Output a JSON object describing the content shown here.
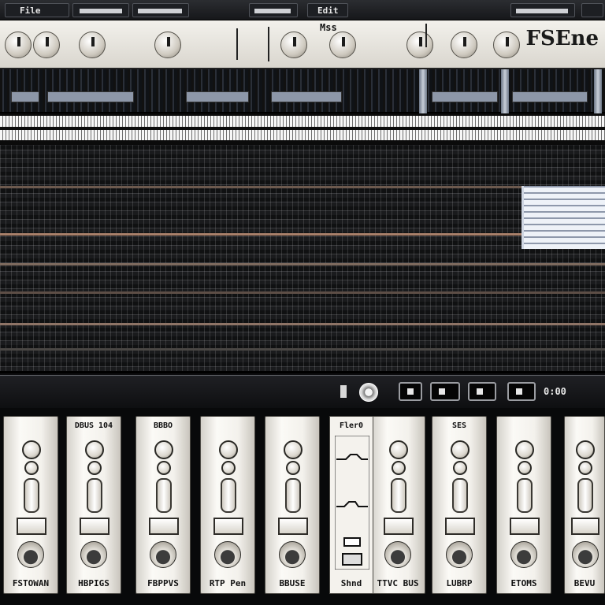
{
  "menubar": {
    "segment_1": "File",
    "segment_3": "Edit"
  },
  "header": {
    "label_1": "FSEne",
    "label_2": "Mss"
  },
  "lowerbar": {
    "counter": "0:00"
  },
  "strips": [
    {
      "title": "",
      "name": "FSTOWAN"
    },
    {
      "title": "DBUS 104",
      "name": "HBPIGS"
    },
    {
      "title": "BBBO",
      "name": "FBPPVS"
    },
    {
      "title": "",
      "name": "RTP Pen"
    },
    {
      "title": "",
      "name": "BBUSE"
    },
    {
      "title": "",
      "name": "TTVC BUS"
    },
    {
      "title": "SES",
      "name": "LUBRP"
    },
    {
      "title": "",
      "name": "ETOMS"
    },
    {
      "title": "",
      "name": "BEVU"
    }
  ],
  "graph_strip": {
    "title": "Fler0",
    "name": "Shnd"
  },
  "colors": {
    "panel": "#f3f1ec",
    "dark": "#0c0c0e",
    "accent_lane": "#a9806a"
  }
}
